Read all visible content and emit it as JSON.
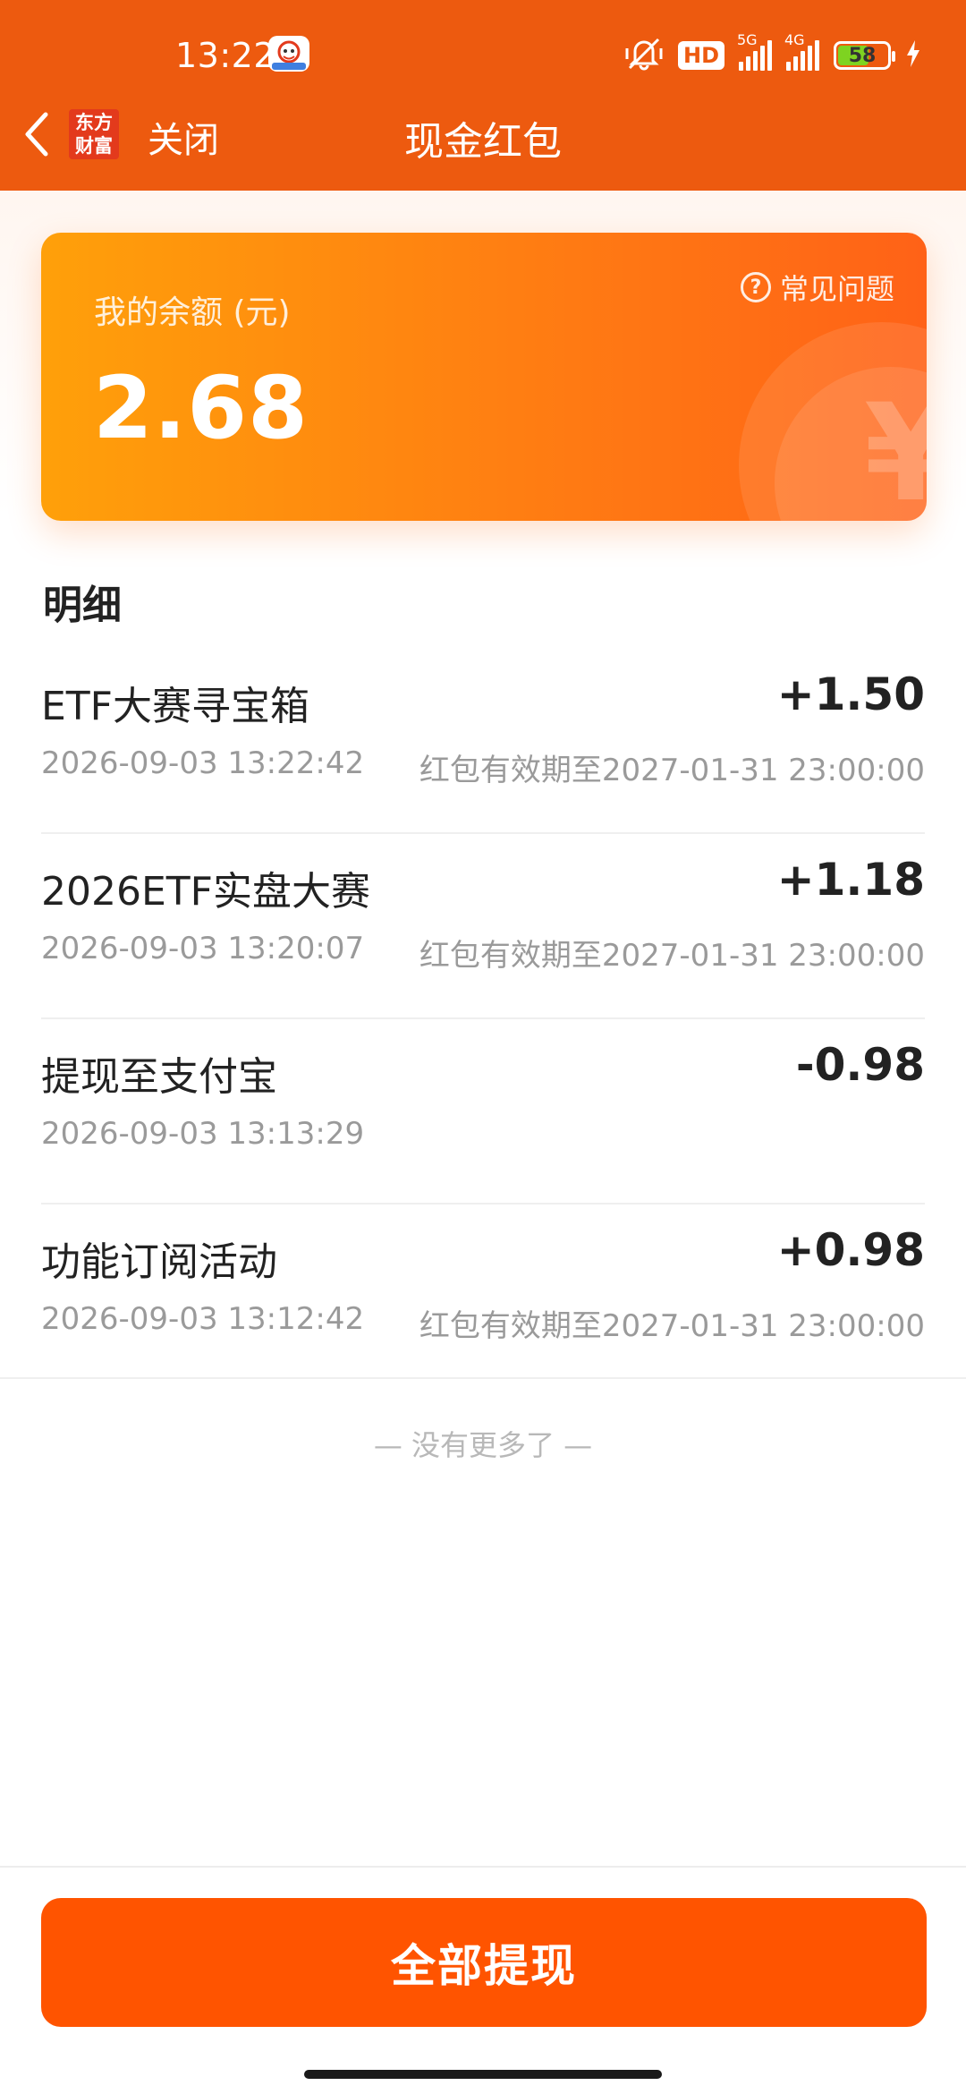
{
  "status_bar": {
    "time": "13:22",
    "hd": "HD",
    "network_5g": "5G",
    "network_4g": "4G",
    "battery": "58",
    "battery_level": 0.58
  },
  "nav": {
    "logo_text": "东方财富",
    "close_label": "关闭",
    "title": "现金红包"
  },
  "balance_card": {
    "faq_label": "常见问题",
    "label": "我的余额 (元)",
    "value": "2.68",
    "currency_symbol": "¥"
  },
  "details": {
    "section_title": "明细",
    "items": [
      {
        "title": "ETF大赛寻宝箱",
        "amount": "+1.50",
        "date": "2026-09-03 13:22:42",
        "expiry": "红包有效期至2027-01-31 23:00:00"
      },
      {
        "title": "2026ETF实盘大赛",
        "amount": "+1.18",
        "date": "2026-09-03 13:20:07",
        "expiry": "红包有效期至2027-01-31 23:00:00"
      },
      {
        "title": "提现至支付宝",
        "amount": "-0.98",
        "date": "2026-09-03 13:13:29",
        "expiry": ""
      },
      {
        "title": "功能订阅活动",
        "amount": "+0.98",
        "date": "2026-09-03 13:12:42",
        "expiry": "红包有效期至2027-01-31 23:00:00"
      }
    ],
    "no_more_text": "— 没有更多了 —"
  },
  "footer": {
    "withdraw_all_label": "全部提现"
  },
  "colors": {
    "header": "#ED5A0F",
    "card_start": "#FFA00A",
    "card_end": "#FF6217",
    "primary_button": "#FF5400"
  }
}
